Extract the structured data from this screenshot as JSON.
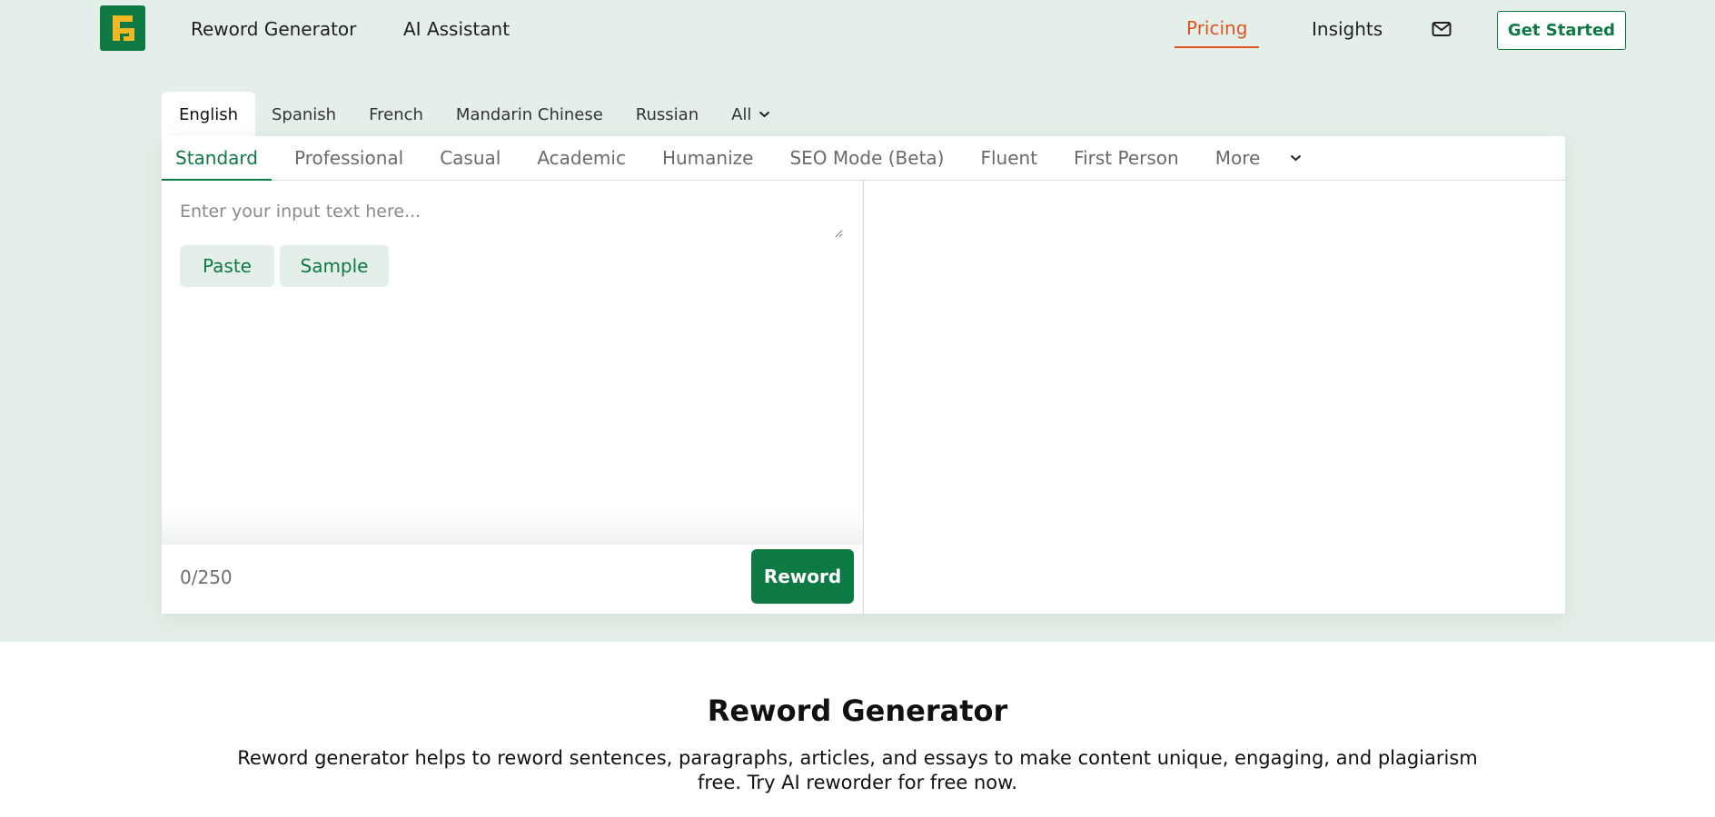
{
  "header": {
    "logo_letters": "RG",
    "nav": [
      {
        "label": "Reword Generator"
      },
      {
        "label": "AI Assistant"
      },
      {
        "label": "Pricing"
      },
      {
        "label": "Insights"
      }
    ],
    "mail_icon": "mail-icon",
    "cta_label": "Get Started"
  },
  "languages": {
    "tabs": [
      "English",
      "Spanish",
      "French",
      "Mandarin Chinese",
      "Russian",
      "All"
    ],
    "active": "English"
  },
  "modes": {
    "tabs": [
      "Standard",
      "Professional",
      "Casual",
      "Academic",
      "Humanize",
      "SEO Mode (Beta)",
      "Fluent",
      "First Person",
      "More"
    ],
    "active": "Standard"
  },
  "editor": {
    "placeholder": "Enter your input text here...",
    "value": "",
    "paste_label": "Paste",
    "sample_label": "Sample",
    "counter": "0/250",
    "submit_label": "Reword"
  },
  "content": {
    "heading": "Reword Generator",
    "description": "Reword generator helps to reword sentences, paragraphs, articles, and essays to make content unique, engaging, and plagiarism free. Try AI reworder for free now."
  },
  "colors": {
    "brand_green": "#0e7a43",
    "brand_yellow": "#f2b824",
    "accent_orange": "#e0531e",
    "hero_bg": "#e5efe9"
  }
}
